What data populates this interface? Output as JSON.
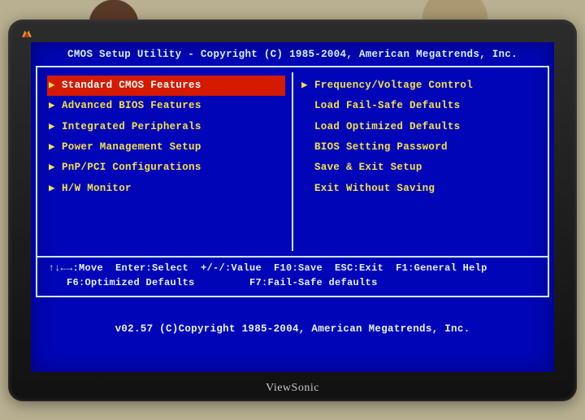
{
  "monitor_brand": "ViewSonic",
  "header": {
    "title": "CMOS Setup Utility - Copyright (C) 1985-2004, American Megatrends, Inc."
  },
  "menu": {
    "left": [
      {
        "label": "Standard CMOS Features",
        "arrow": true,
        "selected": true
      },
      {
        "label": "Advanced BIOS Features",
        "arrow": true,
        "selected": false
      },
      {
        "label": "Integrated Peripherals",
        "arrow": true,
        "selected": false
      },
      {
        "label": "Power Management Setup",
        "arrow": true,
        "selected": false
      },
      {
        "label": "PnP/PCI Configurations",
        "arrow": true,
        "selected": false
      },
      {
        "label": "H/W Monitor",
        "arrow": true,
        "selected": false
      }
    ],
    "right": [
      {
        "label": "Frequency/Voltage Control",
        "arrow": true,
        "selected": false
      },
      {
        "label": "Load Fail-Safe Defaults",
        "arrow": false,
        "selected": false
      },
      {
        "label": "Load Optimized Defaults",
        "arrow": false,
        "selected": false
      },
      {
        "label": "BIOS Setting Password",
        "arrow": false,
        "selected": false
      },
      {
        "label": "Save & Exit Setup",
        "arrow": false,
        "selected": false
      },
      {
        "label": "Exit Without Saving",
        "arrow": false,
        "selected": false
      }
    ]
  },
  "help": {
    "line1": " ↑↓←→:Move  Enter:Select  +/-/:Value  F10:Save  ESC:Exit  F1:General Help",
    "line2": "    F6:Optimized Defaults         F7:Fail-Safe defaults"
  },
  "footer": {
    "text": "v02.57 (C)Copyright 1985-2004, American Megatrends, Inc."
  }
}
